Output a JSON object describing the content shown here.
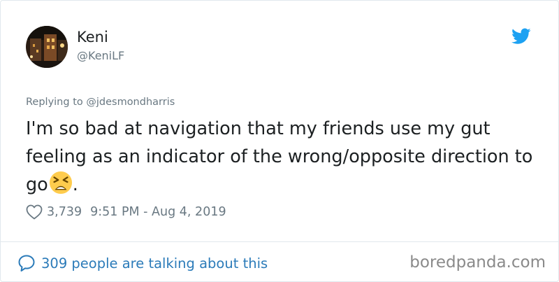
{
  "author": {
    "display_name": "Keni",
    "handle": "@KeniLF",
    "avatar": "profile-photo"
  },
  "reply": {
    "text": "Replying to @jdesmondharris"
  },
  "tweet": {
    "text": "I'm so bad at navigation that my friends use my gut feeling as an indicator of the wrong/opposite direction to go",
    "emoji": "tired-face-emoji",
    "trailing": "."
  },
  "meta": {
    "likes": "3,739",
    "timestamp": "9:51 PM - Aug 4, 2019"
  },
  "footer": {
    "talking": "309 people are talking about this"
  },
  "watermark": "boredpanda.com",
  "icons": {
    "twitter": "twitter-bird-icon",
    "heart": "heart-icon",
    "bubble": "speech-bubble-icon"
  },
  "colors": {
    "twitter_blue": "#1da1f2",
    "link_blue": "#2b7bb9",
    "muted_gray": "#697882",
    "text_dark": "#1c2022"
  }
}
